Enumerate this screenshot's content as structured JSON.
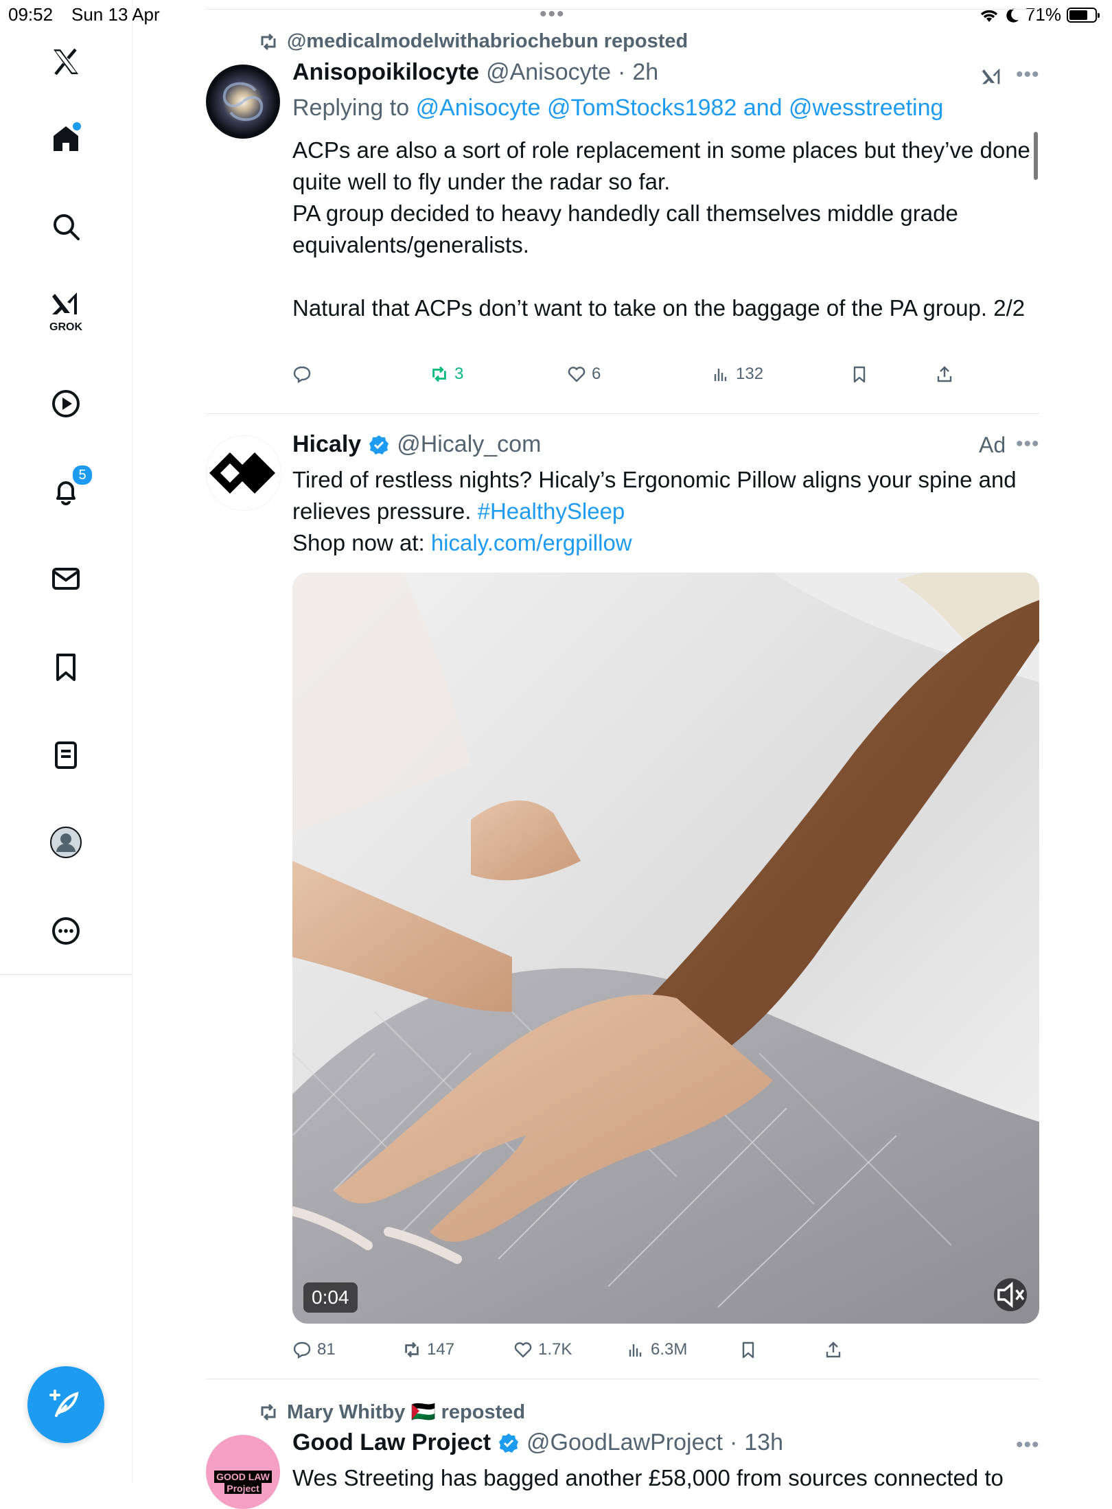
{
  "status_bar": {
    "time": "09:52",
    "date": "Sun 13 Apr",
    "battery": "71%",
    "battery_level": 0.71
  },
  "sidebar": {
    "grok_label": "GROK",
    "notifications_badge": "5",
    "items": [
      "x-logo",
      "home",
      "search",
      "grok",
      "videos",
      "notifications",
      "messages",
      "bookmarks",
      "lists",
      "profile",
      "more"
    ]
  },
  "posts": [
    {
      "repost_by": "@medicalmodelwithabriochebun reposted",
      "name": "Anisopoikilocyte",
      "handle": "@Anisocyte",
      "time": "2h",
      "replying_prefix": "Replying to",
      "replying_1": "@Anisocyte",
      "replying_2": "@TomStocks1982",
      "replying_and": "and",
      "replying_3": "@wesstreeting",
      "lines": [
        "ACPs are also a sort of role replacement in some places but they’ve done quite well to fly under the radar so far.",
        "PA group decided to heavy handedly call themselves middle grade equivalents/generalists.",
        "Natural that ACPs don’t want to take on the baggage of the PA group. 2/2"
      ],
      "reposts": "3",
      "likes": "6",
      "views": "132"
    },
    {
      "name": "Hicaly",
      "handle": "@Hicaly_com",
      "ad_label": "Ad",
      "text_1": "Tired of restless nights? Hicaly’s Ergonomic Pillow aligns your spine and relieves pressure.",
      "hashtag": "#HealthySleep",
      "shop_prefix": "Shop now at:",
      "shop_link": "hicaly.com/ergpillow",
      "video_time": "0:04",
      "replies": "81",
      "reposts": "147",
      "likes": "1.7K",
      "views": "6.3M"
    },
    {
      "repost_by": "Mary Whitby 🇵🇸 reposted",
      "name": "Good Law Project",
      "handle": "@GoodLawProject",
      "time": "13h",
      "avatar_text_1": "GOOD LAW",
      "avatar_text_2": "Project",
      "text_preview": "Wes Streeting has bagged another £58,000 from sources connected to"
    }
  ],
  "colors": {
    "accent": "#1d9bf0",
    "text": "#0f1419",
    "muted": "#536471",
    "repost_green": "#00ba7c"
  }
}
